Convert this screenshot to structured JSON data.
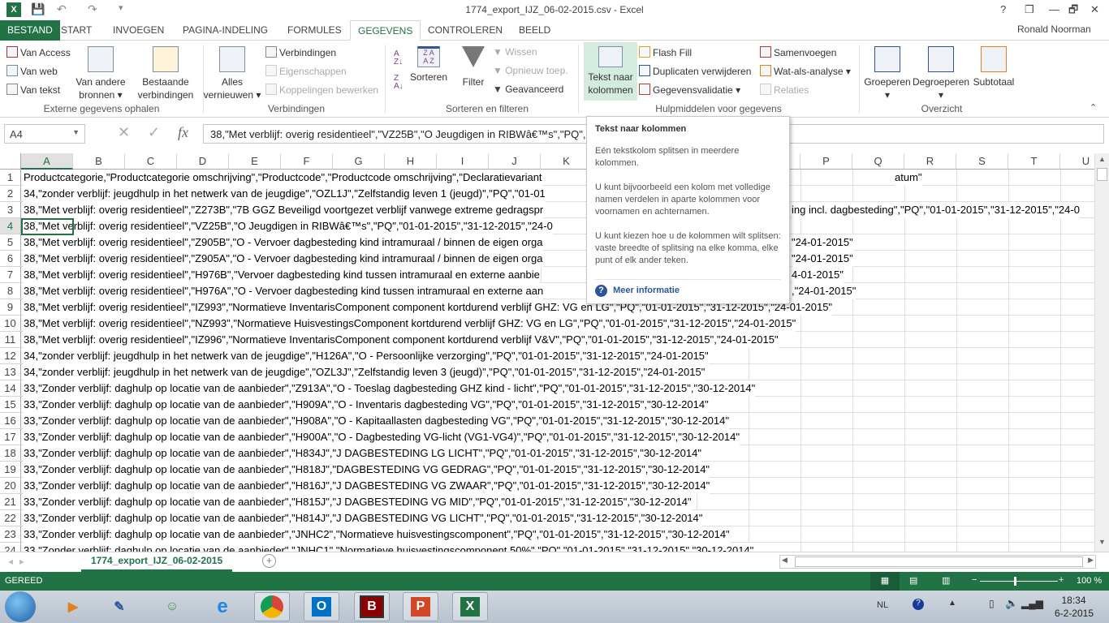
{
  "window": {
    "title": "1774_export_IJZ_06-02-2015.csv - Excel",
    "user": "Ronald Noorman",
    "controls": [
      "?",
      "❐",
      "—",
      "🗗",
      "✕"
    ]
  },
  "tabs": [
    "BESTAND",
    "START",
    "INVOEGEN",
    "PAGINA-INDELING",
    "FORMULES",
    "GEGEVENS",
    "CONTROLEREN",
    "BEELD"
  ],
  "ribbon": {
    "external": {
      "van_access": "Van Access",
      "van_web": "Van web",
      "van_tekst": "Van tekst",
      "van_andere": "Van andere",
      "bronnen": "bronnen",
      "bestaande": "Bestaande",
      "verbindingen_big": "verbindingen",
      "group": "Externe gegevens ophalen"
    },
    "connections": {
      "alles": "Alles",
      "vernieuwen": "vernieuwen",
      "verbindingen": "Verbindingen",
      "eigenschappen": "Eigenschappen",
      "koppelingen": "Koppelingen bewerken",
      "group": "Verbindingen"
    },
    "sort": {
      "sorteren": "Sorteren",
      "filter": "Filter",
      "wissen": "Wissen",
      "opnieuw": "Opnieuw toep.",
      "geavanceerd": "Geavanceerd",
      "group": "Sorteren en filteren"
    },
    "tools": {
      "tekst1": "Tekst naar",
      "tekst2": "kolommen",
      "flash": "Flash Fill",
      "duplicaten": "Duplicaten verwijderen",
      "validatie": "Gegevensvalidatie",
      "samenvoegen": "Samenvoegen",
      "watals": "Wat-als-analyse",
      "relaties": "Relaties",
      "group": "Hulpmiddelen voor gegevens"
    },
    "outline": {
      "groeperen": "Groeperen",
      "degroeperen": "Degroeperen",
      "subtotaal": "Subtotaal",
      "group": "Overzicht"
    }
  },
  "formula_bar": {
    "name_box": "A4",
    "formula": "38,\"Met verblijf: overig residentieel\",\"VZ25B\",\"O Jeugdigen in RIBWâ€™s\",\"PQ\",\"01-01-2015\",\"31-12-2015\",\"24-01-2015\""
  },
  "columns": [
    "A",
    "B",
    "C",
    "D",
    "E",
    "F",
    "G",
    "H",
    "I",
    "J",
    "K",
    "L",
    "M",
    "N",
    "O",
    "P",
    "Q",
    "R",
    "S",
    "T",
    "U"
  ],
  "rows": [
    {
      "n": "1",
      "text": "Productcategorie,\"Productcategorie omschrijving\",\"Productcode\",\"Productcode omschrijving\",\"Declaratievariant",
      "tail": "atum\""
    },
    {
      "n": "2",
      "text": "34,\"zonder verblijf: jeugdhulp in het netwerk van de jeugdige\",\"OZL1J\",\"Zelfstandig leven 1 (jeugd)\",\"PQ\",\"01-01"
    },
    {
      "n": "3",
      "text": "38,\"Met verblijf: overig residentieel\",\"Z273B\",\"7B GGZ Beveiligd voortgezet verblijf vanwege extreme gedragspr",
      "tail": "ing incl. dagbesteding\",\"PQ\",\"01-01-2015\",\"31-12-2015\",\"24-0"
    },
    {
      "n": "4",
      "text": "38,\"Met verblijf: overig residentieel\",\"VZ25B\",\"O Jeugdigen in RIBWâ€™s\",\"PQ\",\"01-01-2015\",\"31-12-2015\",\"24-0"
    },
    {
      "n": "5",
      "text": "38,\"Met verblijf: overig residentieel\",\"Z905B\",\"O - Vervoer dagbesteding kind intramuraal / binnen de eigen orga",
      "tail": "\"24-01-2015\""
    },
    {
      "n": "6",
      "text": "38,\"Met verblijf: overig residentieel\",\"Z905A\",\"O - Vervoer dagbesteding kind intramuraal / binnen de eigen orga",
      "tail": "\"24-01-2015\""
    },
    {
      "n": "7",
      "text": "38,\"Met verblijf: overig residentieel\",\"H976B\",\"Vervoer dagbesteding kind tussen intramuraal en externe aanbie",
      "tail": "4-01-2015\""
    },
    {
      "n": "8",
      "text": "38,\"Met verblijf: overig residentieel\",\"H976A\",\"O - Vervoer dagbesteding kind tussen intramuraal en externe aan",
      "tail": ",\"24-01-2015\""
    },
    {
      "n": "9",
      "text": "38,\"Met verblijf: overig residentieel\",\"IZ993\",\"Normatieve InventarisComponent  component  kortdurend verblijf GHZ: VG en LG\",\"PQ\",\"01-01-2015\",\"31-12-2015\",\"24-01-2015\""
    },
    {
      "n": "10",
      "text": "38,\"Met verblijf: overig residentieel\",\"NZ993\",\"Normatieve HuisvestingsComponent   kortdurend verblijf GHZ: VG en LG\",\"PQ\",\"01-01-2015\",\"31-12-2015\",\"24-01-2015\""
    },
    {
      "n": "11",
      "text": "38,\"Met verblijf: overig residentieel\",\"IZ996\",\"Normatieve InventarisComponent  component kortdurend verblijf V&V\",\"PQ\",\"01-01-2015\",\"31-12-2015\",\"24-01-2015\""
    },
    {
      "n": "12",
      "text": "34,\"zonder verblijf: jeugdhulp in het netwerk van de jeugdige\",\"H126A\",\"O - Persoonlijke verzorging\",\"PQ\",\"01-01-2015\",\"31-12-2015\",\"24-01-2015\""
    },
    {
      "n": "13",
      "text": "34,\"zonder verblijf: jeugdhulp in het netwerk van de jeugdige\",\"OZL3J\",\"Zelfstandig leven 3 (jeugd)\",\"PQ\",\"01-01-2015\",\"31-12-2015\",\"24-01-2015\""
    },
    {
      "n": "14",
      "text": "33,\"Zonder verblijf: daghulp op locatie van de aanbieder\",\"Z913A\",\"O - Toeslag dagbesteding GHZ kind - licht\",\"PQ\",\"01-01-2015\",\"31-12-2015\",\"30-12-2014\""
    },
    {
      "n": "15",
      "text": "33,\"Zonder verblijf: daghulp op locatie van de aanbieder\",\"H909A\",\"O - Inventaris dagbesteding VG\",\"PQ\",\"01-01-2015\",\"31-12-2015\",\"30-12-2014\""
    },
    {
      "n": "16",
      "text": "33,\"Zonder verblijf: daghulp op locatie van de aanbieder\",\"H908A\",\"O - Kapitaallasten dagbesteding VG\",\"PQ\",\"01-01-2015\",\"31-12-2015\",\"30-12-2014\""
    },
    {
      "n": "17",
      "text": "33,\"Zonder verblijf: daghulp op locatie van de aanbieder\",\"H900A\",\"O - Dagbesteding VG-licht (VG1-VG4)\",\"PQ\",\"01-01-2015\",\"31-12-2015\",\"30-12-2014\""
    },
    {
      "n": "18",
      "text": "33,\"Zonder verblijf: daghulp op locatie van de aanbieder\",\"H834J\",\"J DAGBESTEDING LG LICHT\",\"PQ\",\"01-01-2015\",\"31-12-2015\",\"30-12-2014\""
    },
    {
      "n": "19",
      "text": "33,\"Zonder verblijf: daghulp op locatie van de aanbieder\",\"H818J\",\"DAGBESTEDING VG GEDRAG\",\"PQ\",\"01-01-2015\",\"31-12-2015\",\"30-12-2014\""
    },
    {
      "n": "20",
      "text": "33,\"Zonder verblijf: daghulp op locatie van de aanbieder\",\"H816J\",\"J DAGBESTEDING VG ZWAAR\",\"PQ\",\"01-01-2015\",\"31-12-2015\",\"30-12-2014\""
    },
    {
      "n": "21",
      "text": "33,\"Zonder verblijf: daghulp op locatie van de aanbieder\",\"H815J\",\"J DAGBESTEDING VG MID\",\"PQ\",\"01-01-2015\",\"31-12-2015\",\"30-12-2014\""
    },
    {
      "n": "22",
      "text": "33,\"Zonder verblijf: daghulp op locatie van de aanbieder\",\"H814J\",\"J DAGBESTEDING VG LICHT\",\"PQ\",\"01-01-2015\",\"31-12-2015\",\"30-12-2014\""
    },
    {
      "n": "23",
      "text": "33,\"Zonder verblijf: daghulp op locatie van de aanbieder\",\"JNHC2\",\"Normatieve huisvestingscomponent\",\"PQ\",\"01-01-2015\",\"31-12-2015\",\"30-12-2014\""
    },
    {
      "n": "24",
      "text": "33,\"Zonder verblijf: daghulp op locatie van de aanbieder\",\"JNHC1\",\"Normatieve huisvestingscomponent 50%\",\"PQ\",\"01-01-2015\",\"31-12-2015\",\"30-12-2014\""
    }
  ],
  "tooltip": {
    "title": "Tekst naar kolommen",
    "p1": "Eén tekstkolom splitsen in meerdere kolommen.",
    "p2": "U kunt bijvoorbeeld een kolom met volledige namen verdelen in aparte kolommen voor voornamen en achternamen.",
    "p3": "U kunt kiezen hoe u de kolommen wilt splitsen: vaste breedte of splitsing na elke komma, elke punt of elk ander teken.",
    "link": "Meer informatie"
  },
  "sheet_tab": "1774_export_IJZ_06-02-2015",
  "status": {
    "ready": "GEREED",
    "zoom": "100 %",
    "zoom_percent": 100
  },
  "taskbar": {
    "lang": "NL",
    "time": "18:34",
    "date": "6-2-2015"
  },
  "colors": {
    "accent": "#217346",
    "tooltip_link": "#2b579a"
  }
}
